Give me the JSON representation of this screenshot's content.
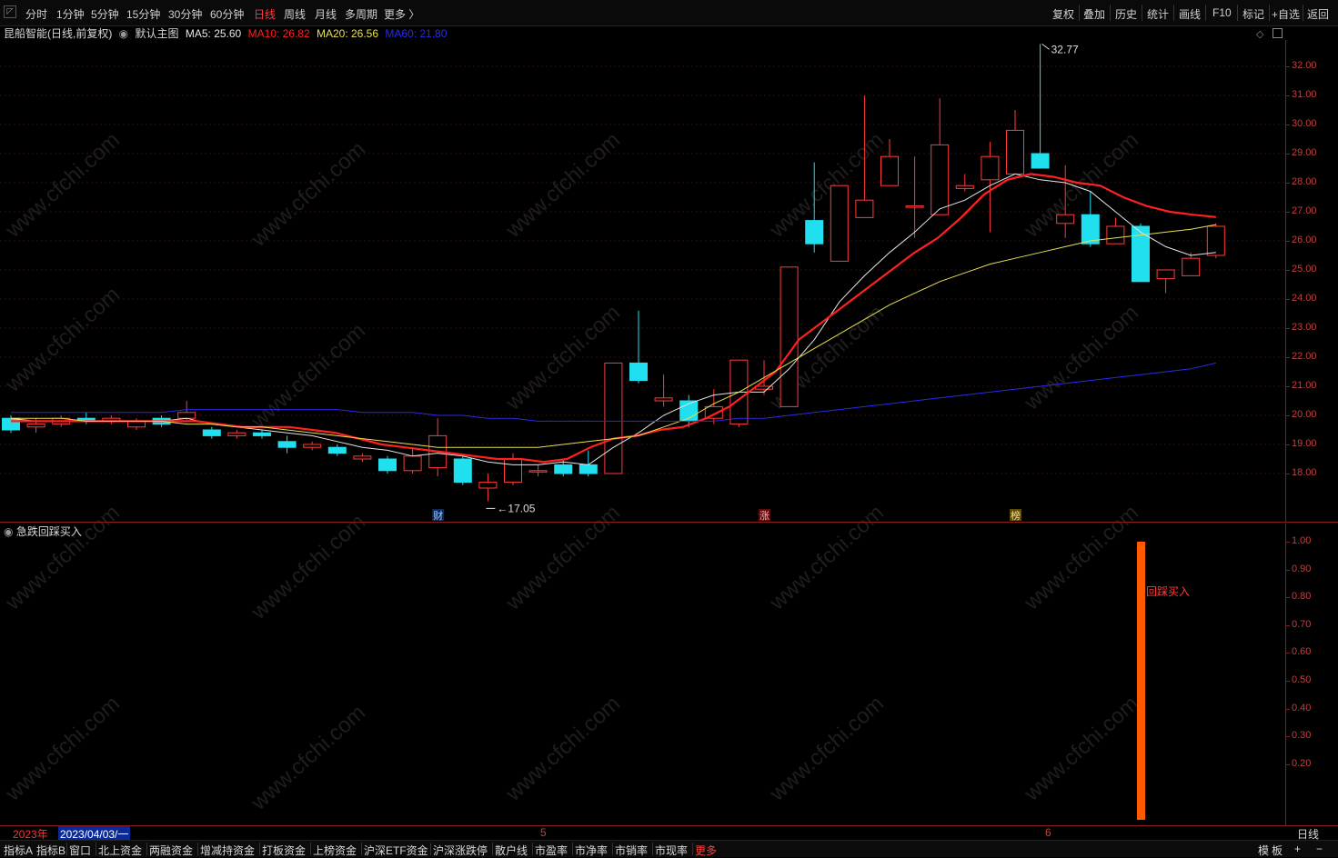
{
  "toolbar": {
    "period_tabs": [
      "分时",
      "1分钟",
      "5分钟",
      "15分钟",
      "30分钟",
      "60分钟",
      "日线",
      "周线",
      "月线",
      "多周期",
      "更多 〉"
    ],
    "active_tab": "日线",
    "right_buttons": [
      "复权",
      "叠加",
      "历史",
      "统计",
      "画线",
      "F10",
      "标记",
      "+自选",
      "返回"
    ]
  },
  "main_info": {
    "stock": "昆船智能(日线,前复权)",
    "template": "默认主图",
    "ma5": "MA5: 25.60",
    "ma10": "MA10: 26.82",
    "ma20": "MA20: 26.56",
    "ma60": "MA60: 21.80"
  },
  "colors": {
    "ma5": "#e6e6e6",
    "ma10": "#ff2020",
    "ma20": "#e8e050",
    "ma60": "#2a2ae8",
    "up": "#ff3b3b",
    "down": "#20e0f0",
    "signal": "#ff5a00"
  },
  "chart_data": [
    {
      "type": "candlestick",
      "price_axis": [
        "32.00",
        "31.00",
        "30.00",
        "29.00",
        "28.00",
        "27.00",
        "26.00",
        "25.00",
        "24.00",
        "23.00",
        "22.00",
        "21.00",
        "20.00",
        "19.00",
        "18.00"
      ],
      "ylim": [
        17,
        33
      ],
      "max_label": "32.77",
      "min_label": "17.05",
      "event_markers": [
        "财",
        "涨",
        "榜"
      ],
      "candles": [
        [
          19.9,
          19.5,
          20.0,
          19.4
        ],
        [
          19.6,
          19.7,
          19.9,
          19.4
        ],
        [
          19.7,
          19.9,
          20.0,
          19.6
        ],
        [
          19.9,
          19.8,
          20.1,
          19.7
        ],
        [
          19.8,
          19.9,
          20.0,
          19.7
        ],
        [
          19.6,
          19.8,
          19.9,
          19.5
        ],
        [
          19.9,
          19.7,
          20.0,
          19.6
        ],
        [
          19.9,
          20.1,
          20.5,
          19.8
        ],
        [
          19.5,
          19.3,
          19.6,
          19.2
        ],
        [
          19.3,
          19.4,
          19.5,
          19.2
        ],
        [
          19.4,
          19.3,
          19.5,
          19.2
        ],
        [
          19.1,
          18.9,
          19.3,
          18.7
        ],
        [
          18.9,
          19.0,
          19.1,
          18.8
        ],
        [
          18.9,
          18.7,
          19.0,
          18.6
        ],
        [
          18.5,
          18.6,
          18.7,
          18.4
        ],
        [
          18.5,
          18.1,
          18.6,
          18.0
        ],
        [
          18.1,
          18.6,
          18.9,
          18.0
        ],
        [
          18.2,
          19.3,
          19.9,
          17.9
        ],
        [
          18.5,
          17.7,
          18.6,
          17.6
        ],
        [
          17.5,
          17.7,
          18.0,
          17.05
        ],
        [
          17.7,
          18.5,
          18.7,
          17.6
        ],
        [
          18.1,
          18.1,
          18.3,
          17.9
        ],
        [
          18.3,
          18.0,
          18.5,
          17.9
        ],
        [
          18.3,
          18.0,
          18.8,
          17.9
        ],
        [
          18.0,
          21.8,
          21.8,
          18.0
        ],
        [
          21.8,
          21.2,
          23.6,
          21.1
        ],
        [
          20.5,
          20.6,
          21.4,
          20.3
        ],
        [
          20.5,
          19.8,
          20.7,
          19.6
        ],
        [
          19.9,
          20.3,
          20.9,
          19.7
        ],
        [
          19.7,
          21.9,
          21.9,
          19.6
        ],
        [
          20.9,
          21.0,
          21.9,
          20.7
        ],
        [
          20.3,
          25.1,
          25.1,
          20.3
        ],
        [
          26.7,
          25.9,
          28.7,
          25.6
        ],
        [
          25.3,
          27.9,
          27.9,
          25.3
        ],
        [
          26.8,
          27.4,
          31.0,
          26.8
        ],
        [
          27.9,
          28.9,
          29.5,
          27.9
        ],
        [
          27.2,
          27.2,
          28.9,
          26.1
        ],
        [
          26.9,
          29.3,
          30.9,
          26.9
        ],
        [
          27.8,
          27.9,
          28.3,
          27.7
        ],
        [
          28.1,
          28.9,
          29.4,
          26.3
        ],
        [
          28.3,
          29.8,
          30.5,
          28.3
        ],
        [
          29.0,
          28.5,
          32.77,
          28.5
        ],
        [
          26.6,
          26.9,
          28.6,
          26.1
        ],
        [
          26.9,
          25.9,
          27.7,
          25.8
        ],
        [
          25.9,
          26.5,
          26.8,
          25.9
        ],
        [
          26.5,
          24.6,
          26.6,
          24.6
        ],
        [
          24.7,
          25.0,
          25.0,
          24.2
        ],
        [
          24.8,
          25.4,
          25.6,
          24.8
        ],
        [
          25.5,
          26.5,
          26.6,
          25.4
        ]
      ],
      "ma_lines": [
        {
          "name": "MA5",
          "color": "#e6e6e6",
          "values": [
            19.9,
            19.8,
            19.8,
            19.8,
            19.8,
            19.8,
            19.8,
            19.9,
            19.7,
            19.6,
            19.5,
            19.4,
            19.3,
            19.1,
            18.9,
            18.8,
            18.6,
            18.7,
            18.6,
            18.4,
            18.3,
            18.3,
            18.4,
            18.3,
            18.9,
            19.4,
            20.0,
            20.4,
            20.7,
            20.8,
            20.8,
            21.6,
            22.6,
            23.9,
            24.8,
            25.6,
            26.3,
            27.1,
            27.4,
            27.9,
            28.3,
            28.1,
            28.0,
            27.7,
            27.0,
            26.3,
            25.8,
            25.5,
            25.6
          ]
        },
        {
          "name": "MA10",
          "color": "#ff2020",
          "values": [
            19.8,
            19.8,
            19.8,
            19.8,
            19.8,
            19.8,
            19.8,
            19.8,
            19.8,
            19.7,
            19.6,
            19.6,
            19.6,
            19.5,
            19.4,
            19.2,
            19.0,
            18.9,
            18.8,
            18.7,
            18.6,
            18.5,
            18.5,
            18.4,
            18.5,
            18.9,
            19.2,
            19.3,
            19.5,
            19.6,
            19.9,
            20.3,
            20.9,
            21.5,
            22.6,
            23.2,
            23.8,
            24.4,
            25.0,
            25.6,
            26.1,
            26.8,
            27.6,
            28.1,
            28.3,
            28.2,
            28.0,
            27.9,
            27.5,
            27.2,
            27.0,
            26.9,
            26.82
          ]
        },
        {
          "name": "MA20",
          "color": "#e8e050",
          "values": [
            19.9,
            19.9,
            19.9,
            19.8,
            19.8,
            19.8,
            19.8,
            19.7,
            19.7,
            19.6,
            19.6,
            19.5,
            19.4,
            19.3,
            19.2,
            19.1,
            19.0,
            18.9,
            18.9,
            18.9,
            18.9,
            18.9,
            19.0,
            19.1,
            19.2,
            19.3,
            19.6,
            19.9,
            20.4,
            20.8,
            21.3,
            21.8,
            22.3,
            22.8,
            23.3,
            23.8,
            24.2,
            24.6,
            24.9,
            25.2,
            25.4,
            25.6,
            25.8,
            26.0,
            26.1,
            26.2,
            26.3,
            26.4,
            26.56
          ]
        },
        {
          "name": "MA60",
          "color": "#2a2ae8",
          "values": [
            20.1,
            20.1,
            20.1,
            20.1,
            20.1,
            20.1,
            20.1,
            20.2,
            20.2,
            20.2,
            20.2,
            20.2,
            20.2,
            20.2,
            20.1,
            20.1,
            20.1,
            20.0,
            20.0,
            19.9,
            19.9,
            19.8,
            19.8,
            19.8,
            19.8,
            19.8,
            19.8,
            19.8,
            19.8,
            19.9,
            19.9,
            20.0,
            20.1,
            20.2,
            20.3,
            20.4,
            20.5,
            20.6,
            20.7,
            20.8,
            20.9,
            21.0,
            21.1,
            21.2,
            21.3,
            21.4,
            21.5,
            21.6,
            21.8
          ]
        }
      ]
    },
    {
      "type": "bar",
      "title": "急跌回踩买入",
      "signal_label": "回踩买入",
      "ylim": [
        0,
        1.0
      ],
      "axis": [
        "1.00",
        "0.90",
        "0.80",
        "0.70",
        "0.60",
        "0.50",
        "0.40",
        "0.30",
        "0.20"
      ],
      "signal_index": 45,
      "signal_value": 1.0
    }
  ],
  "date_axis": {
    "year": "2023年",
    "cursor_date": "2023/04/03/一",
    "month_5": "5",
    "month_6": "6",
    "period": "日线"
  },
  "bottom_tabs": [
    "指标A",
    "指标B",
    "窗口",
    "北上资金",
    "两融资金",
    "增减持资金",
    "打板资金",
    "上榜资金",
    "沪深ETF资金",
    "沪深涨跌停",
    "散户线",
    "市盈率",
    "市净率",
    "市销率",
    "市现率",
    "更多"
  ],
  "bottom_right": [
    "模",
    "板",
    "+",
    "−"
  ],
  "watermark": "www.cfchi.com"
}
